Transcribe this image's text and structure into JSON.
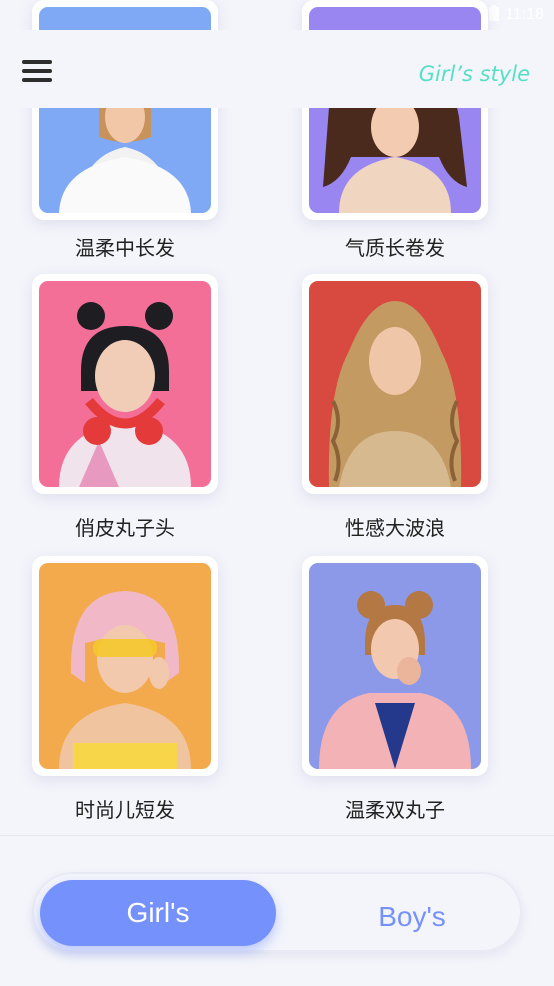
{
  "status_bar": {
    "time": "11:18"
  },
  "header": {
    "title": "Girl’s style"
  },
  "styles": [
    {
      "label": "温柔中长发",
      "photo": "portrait-blue-white-shirt",
      "bg": "#7fa8f5"
    },
    {
      "label": "气质长卷发",
      "photo": "portrait-purple-curly",
      "bg": "#9a86f0"
    },
    {
      "label": "俏皮丸子头",
      "photo": "portrait-pink-buns-headphones",
      "bg": "#f36f98"
    },
    {
      "label": "性感大波浪",
      "photo": "portrait-red-wavy-blonde",
      "bg": "#d8493f"
    },
    {
      "label": "时尚儿短发",
      "photo": "portrait-orange-pink-bob",
      "bg": "#f3aa4c"
    },
    {
      "label": "温柔双丸子",
      "photo": "portrait-periwinkle-double-buns",
      "bg": "#8c99e8"
    }
  ],
  "gender_toggle": {
    "girl_label": "Girl's",
    "boy_label": "Boy's",
    "selected": "girl"
  },
  "colors": {
    "accent": "#7591fb",
    "brand": "#55e0c5",
    "background": "#f4f5fb"
  },
  "icons": {
    "menu": "hamburger-menu-icon",
    "wifi": "wifi-icon",
    "signal": "signal-icon",
    "battery": "battery-icon"
  }
}
